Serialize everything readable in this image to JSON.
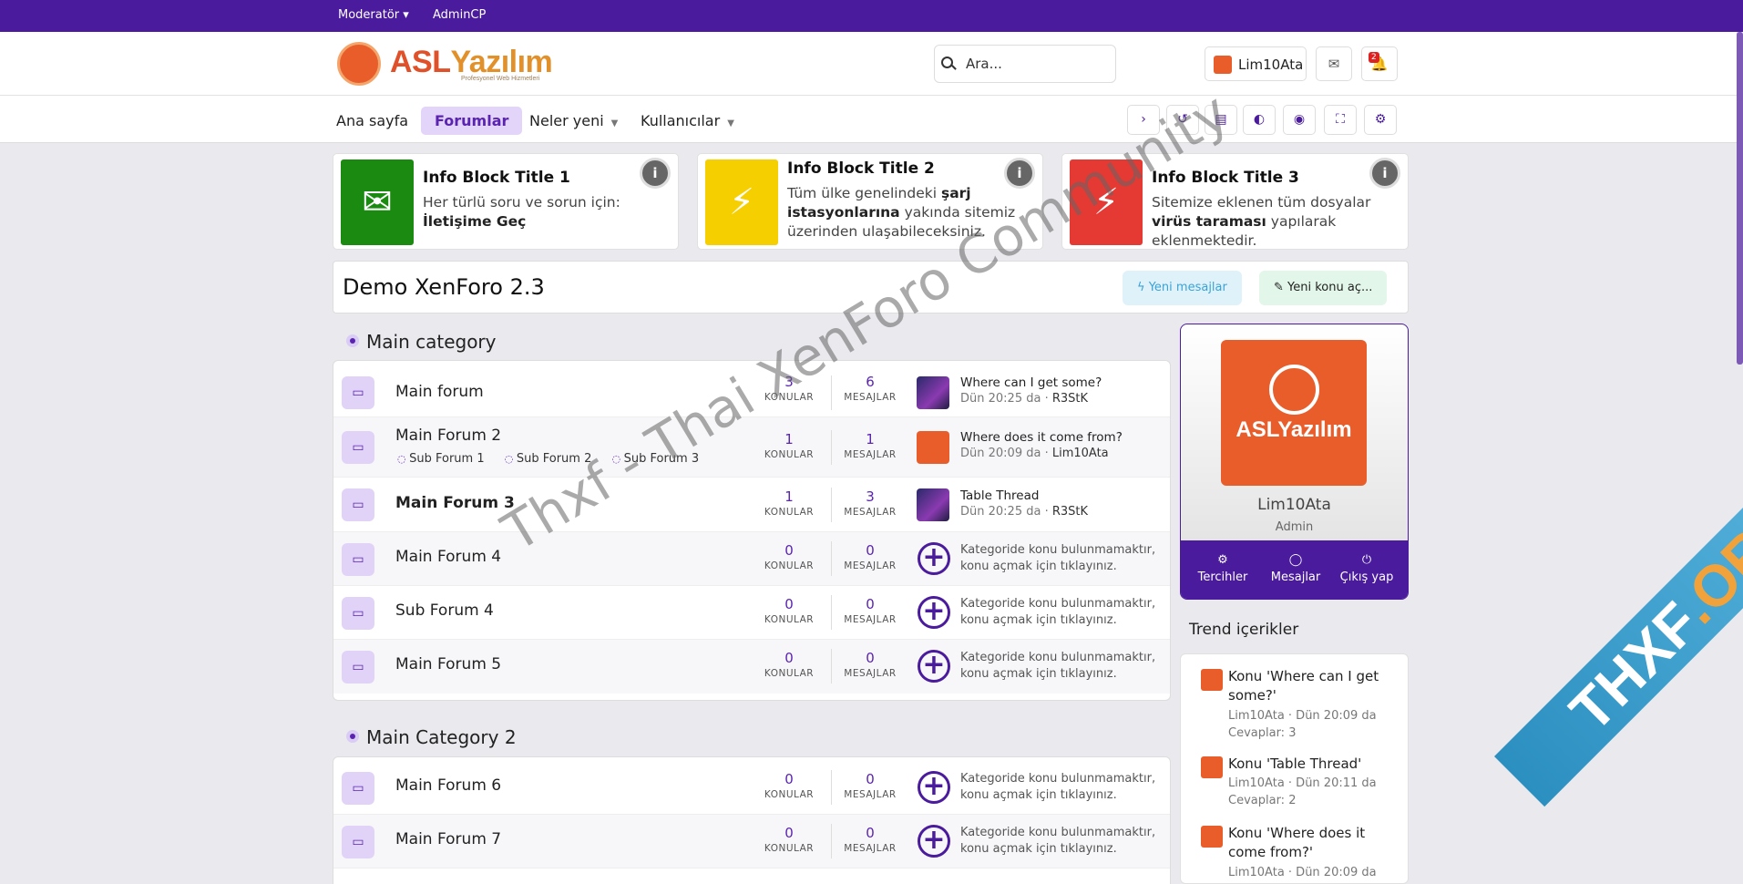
{
  "topbar": {
    "moderator": "Moderatör ▾",
    "admincp": "AdminCP"
  },
  "header": {
    "logo_text_a": "ASL",
    "logo_text_b": "Yazılım",
    "logo_sub": "Profesyonel Web Hizmetleri",
    "search_placeholder": "Ara...",
    "username": "Lim10Ata",
    "notif_count": "2"
  },
  "nav": {
    "home": "Ana sayfa",
    "forums": "Forumlar",
    "whats_new": "Neler yeni",
    "members": "Kullanıcılar"
  },
  "info_blocks": [
    {
      "title": "Info Block Title 1",
      "text_a": "Her türlü soru ve sorun için: ",
      "text_b": "İletişime Geç",
      "text_c": "",
      "color": "#1a8a10"
    },
    {
      "title": "Info Block Title 2",
      "text_a": "Tüm ülke genelindeki ",
      "text_b": "şarj istasyonlarına",
      "text_c": " yakında sitemiz üzerinden ulaşabileceksiniz.",
      "color": "#f5cf00"
    },
    {
      "title": "Info Block Title 3",
      "text_a": "Sitemize eklenen tüm dosyalar ",
      "text_b": "virüs taraması",
      "text_c": " yapılarak eklenmektedir.",
      "color": "#e53a34"
    }
  ],
  "page": {
    "title": "Demo XenForo 2.3",
    "new_posts": "Yeni mesajlar",
    "new_thread": "Yeni konu aç..."
  },
  "labels": {
    "threads": "KONULAR",
    "messages": "MESAJLAR"
  },
  "categories": [
    {
      "name": "Main category",
      "forums": [
        {
          "name": "Main forum",
          "threads": "3",
          "messages": "6",
          "last_title": "Where can I get some?",
          "last_date": "Dün 20:25 da · ",
          "last_user": "R3StK"
        },
        {
          "name": "Main Forum 2",
          "subforums": [
            "Sub Forum 1",
            "Sub Forum 2",
            "Sub Forum 3"
          ],
          "threads": "1",
          "messages": "1",
          "last_title": "Where does it come from?",
          "last_date": "Dün 20:09 da · ",
          "last_user": "Lim10Ata"
        },
        {
          "name": "Main Forum 3",
          "threads": "1",
          "messages": "3",
          "last_title": "Table Thread",
          "last_date": "Dün 20:25 da · ",
          "last_user": "R3StK"
        },
        {
          "name": "Main Forum 4",
          "threads": "0",
          "messages": "0",
          "empty": "Kategoride konu bulunmamaktır, konu açmak için tıklayınız."
        },
        {
          "name": "Sub Forum 4",
          "threads": "0",
          "messages": "0",
          "empty": "Kategoride konu bulunmamaktır, konu açmak için tıklayınız."
        },
        {
          "name": "Main Forum 5",
          "threads": "0",
          "messages": "0",
          "empty": "Kategoride konu bulunmamaktır, konu açmak için tıklayınız."
        }
      ]
    },
    {
      "name": "Main Category 2",
      "forums": [
        {
          "name": "Main Forum 6",
          "threads": "0",
          "messages": "0",
          "empty": "Kategoride konu bulunmamaktır, konu açmak için tıklayınız."
        },
        {
          "name": "Main Forum 7",
          "threads": "0",
          "messages": "0",
          "empty": "Kategoride konu bulunmamaktır, konu açmak için tıklayınız."
        }
      ]
    }
  ],
  "sidebar": {
    "logo_text": "ASLYazılım",
    "name": "Lim10Ata",
    "role": "Admin",
    "prefs": "Tercihler",
    "messages": "Mesajlar",
    "logout": "Çıkış yap",
    "trend_title": "Trend içerikler",
    "trends": [
      {
        "title": "Konu 'Where can I get some?'",
        "meta1": "Lim10Ata · Dün 20:09 da",
        "meta2": "Cevaplar: 3"
      },
      {
        "title": "Konu 'Table Thread'",
        "meta1": "Lim10Ata · Dün 20:11 da",
        "meta2": "Cevaplar: 2"
      },
      {
        "title": "Konu 'Where does it come from?'",
        "meta1": "Lim10Ata · Dün 20:09 da",
        "meta2": ""
      }
    ]
  },
  "watermark": {
    "text": "Thxf - Thai XenForo Community",
    "ribbon_a": "THXF",
    "ribbon_b": ".ORG"
  }
}
